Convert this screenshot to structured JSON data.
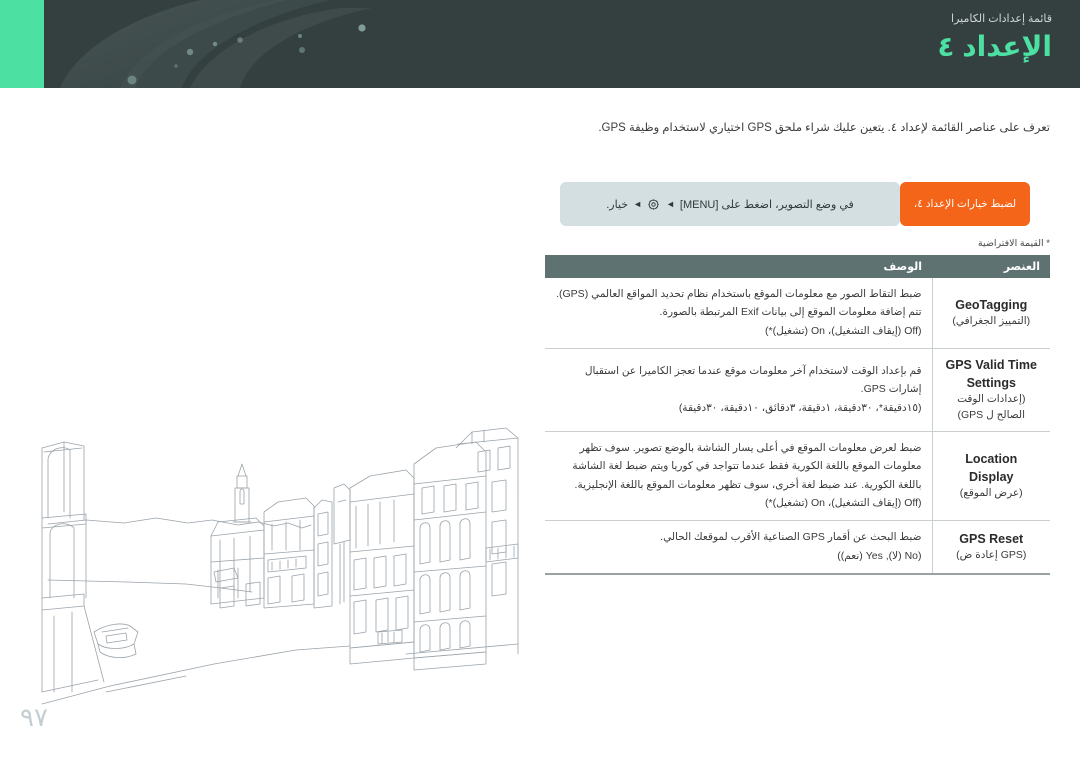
{
  "header": {
    "kicker": "قائمة إعدادات الكاميرا",
    "title": "الإعداد ٤",
    "accent_color": "#4ce0a3",
    "background_color": "#343f3f"
  },
  "intro": {
    "paragraph": "تعرف على عناصر القائمة لإعداد ٤. يتعين عليك شراء ملحق GPS اختياري لاستخدام وظيفة GPS."
  },
  "callout": {
    "tab_label": "لضبط خيارات الإعداد ٤،",
    "tab_color": "#f4651a",
    "body_color": "#d3dfe0",
    "body_prefix": "في وضع التصوير، اضغط على [MENU]",
    "gear_icon": "gear-icon",
    "arrow_glyph": "◄",
    "body_suffix": "خيار."
  },
  "default_note": "* القيمة الافتراضية",
  "table": {
    "headers": {
      "item": "العنصر",
      "description": "الوصف"
    },
    "rows": [
      {
        "name_en": "GeoTagging",
        "name_ar": "(التمييز الجغرافي)",
        "description": "ضبط التقاط الصور مع معلومات الموقع باستخدام نظام تحديد المواقع العالمي (GPS). تتم إضافة معلومات الموقع إلى بيانات Exif المرتبطة بالصورة.",
        "options_prefix": "",
        "options": "Off (إيقاف التشغيل)، On (تشغيل)*)",
        "options_display": "(Off (إيقاف التشغيل)، On (تشغيل)*)"
      },
      {
        "name_en": "GPS Valid Time Settings",
        "name_ar": "(إعدادات الوقت الصالح ل GPS)",
        "description": "قم بإعداد الوقت لاستخدام آخر معلومات موقع عندما تعجز الكاميرا عن استقبال إشارات GPS.",
        "options_display": "(١٥دقيقة*، ٣٠دقيقة، ١دقيقة، ٣دقائق، ١٠دقيقة، ٣٠دقيقة)"
      },
      {
        "name_en": "Location Display",
        "name_ar": "(عرض الموقع)",
        "description": "ضبط لعرض معلومات الموقع في أعلى يسار الشاشة بالوضع تصوير. سوف تظهر معلومات الموقع باللغة الكورية فقط عندما تتواجد في كوريا ويتم ضبط لغة الشاشة باللغة الكورية. عند ضبط لغة أخرى، سوف تظهر معلومات الموقع باللغة الإنجليزية.",
        "options_display": "(Off (إيقاف التشغيل)، On (تشغيل)*)"
      },
      {
        "name_en": "GPS Reset",
        "name_ar": "(GPS إعادة ض)",
        "description": "ضبط البحث عن أقمار GPS الصناعية الأقرب لموقعك الحالي.",
        "options_display": "(No (لا), Yes (نعم))"
      }
    ]
  },
  "illustration": {
    "name": "venice-canal-line-art",
    "alt": "رسم خطي لقناة مائية ومبانٍ وقارب"
  },
  "page_number": "٩٧"
}
